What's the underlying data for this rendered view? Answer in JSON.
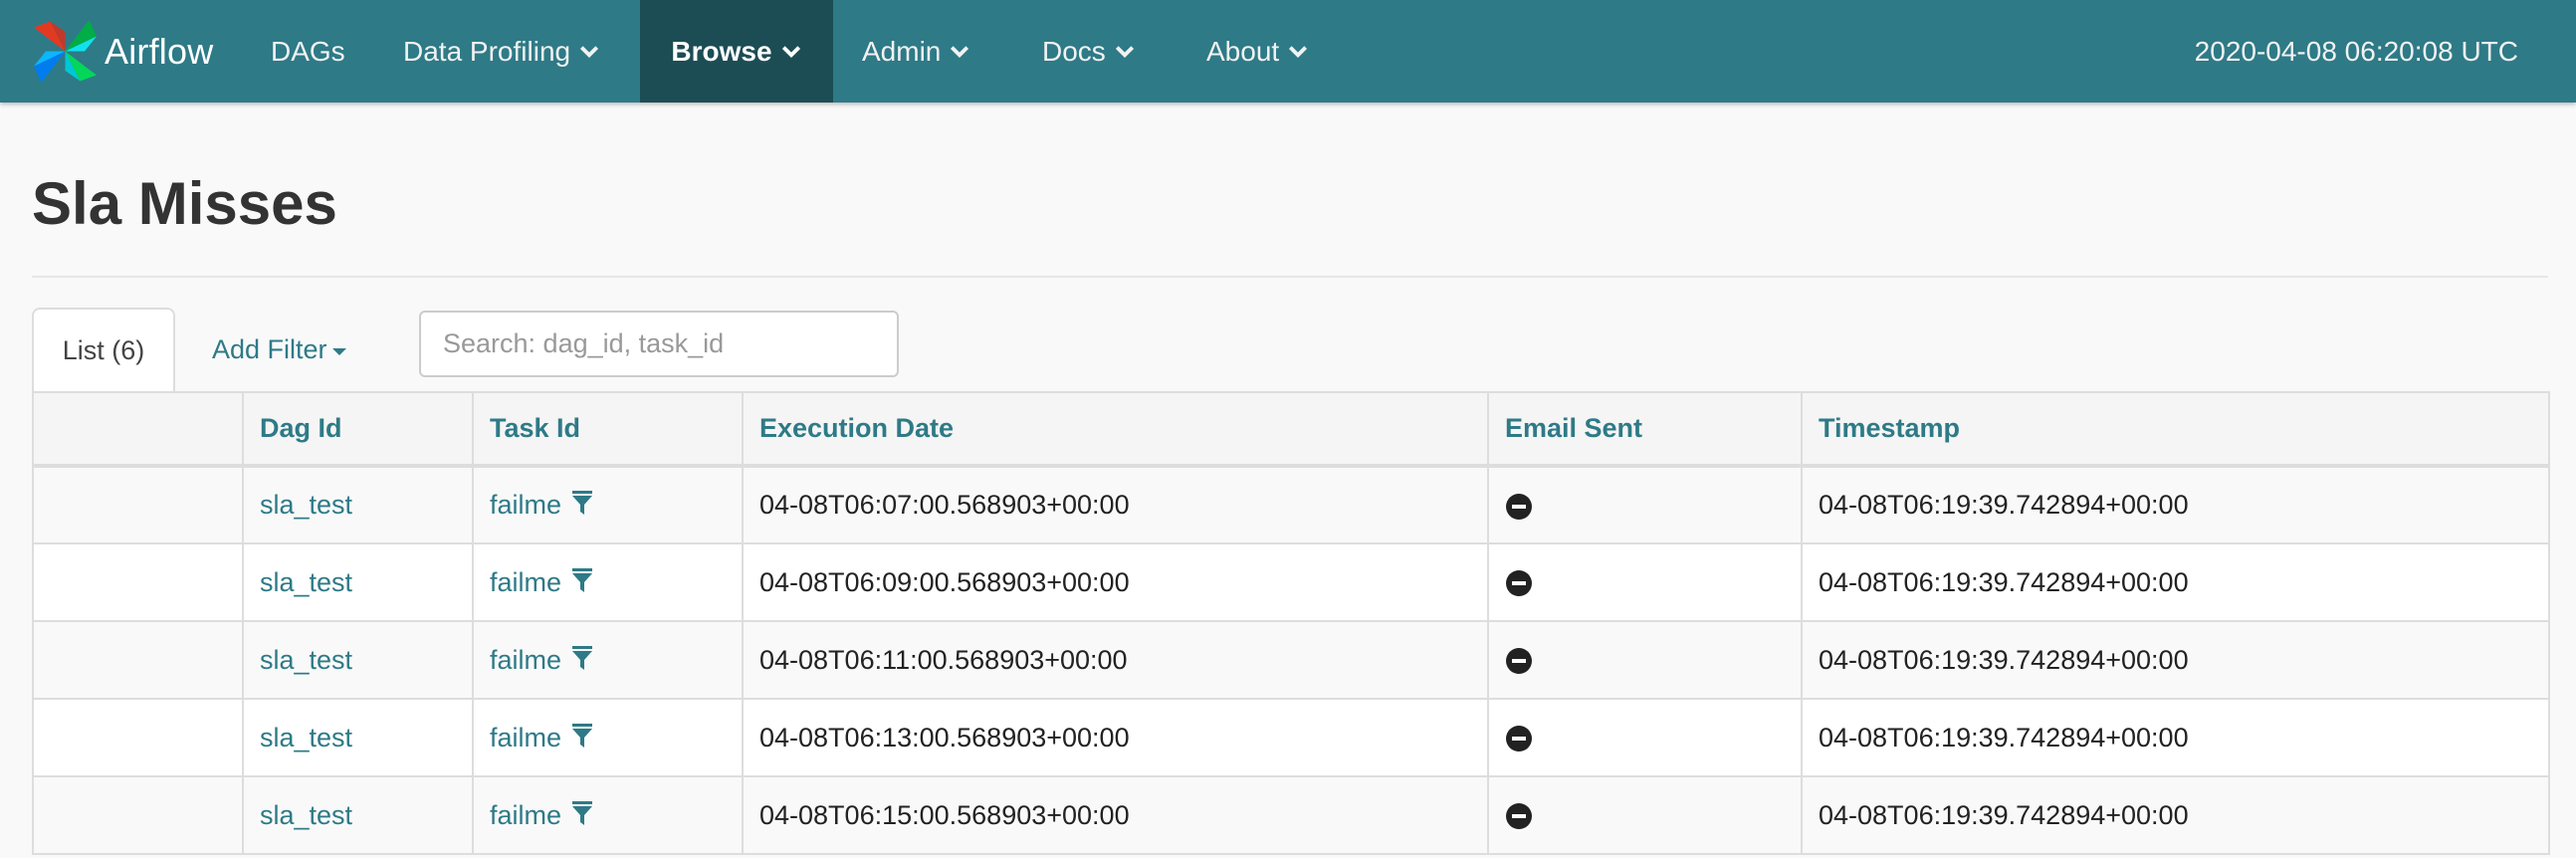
{
  "navbar": {
    "brand": "Airflow",
    "items": [
      {
        "label": "DAGs",
        "dropdown": false,
        "active": false
      },
      {
        "label": "Data Profiling",
        "dropdown": true,
        "active": false
      },
      {
        "label": "Browse",
        "dropdown": true,
        "active": true
      },
      {
        "label": "Admin",
        "dropdown": true,
        "active": false
      },
      {
        "label": "Docs",
        "dropdown": true,
        "active": false
      },
      {
        "label": "About",
        "dropdown": true,
        "active": false
      }
    ],
    "clock": "2020-04-08 06:20:08 UTC",
    "bg_color": "#2e7a87",
    "active_color": "#1c4d55"
  },
  "page": {
    "title": "Sla Misses"
  },
  "tabs": {
    "list_label": "List (6)",
    "add_filter_label": "Add Filter"
  },
  "search": {
    "placeholder": "Search: dag_id, task_id",
    "value": ""
  },
  "table": {
    "columns": [
      "",
      "Dag Id",
      "Task Id",
      "Execution Date",
      "Email Sent",
      "Timestamp"
    ],
    "rows": [
      {
        "dag_id": "sla_test",
        "task_id": "failme",
        "execution_date": "04-08T06:07:00.568903+00:00",
        "email_sent": "minus-circle-icon",
        "timestamp": "04-08T06:19:39.742894+00:00"
      },
      {
        "dag_id": "sla_test",
        "task_id": "failme",
        "execution_date": "04-08T06:09:00.568903+00:00",
        "email_sent": "minus-circle-icon",
        "timestamp": "04-08T06:19:39.742894+00:00"
      },
      {
        "dag_id": "sla_test",
        "task_id": "failme",
        "execution_date": "04-08T06:11:00.568903+00:00",
        "email_sent": "minus-circle-icon",
        "timestamp": "04-08T06:19:39.742894+00:00"
      },
      {
        "dag_id": "sla_test",
        "task_id": "failme",
        "execution_date": "04-08T06:13:00.568903+00:00",
        "email_sent": "minus-circle-icon",
        "timestamp": "04-08T06:19:39.742894+00:00"
      },
      {
        "dag_id": "sla_test",
        "task_id": "failme",
        "execution_date": "04-08T06:15:00.568903+00:00",
        "email_sent": "minus-circle-icon",
        "timestamp": "04-08T06:19:39.742894+00:00"
      }
    ]
  },
  "colors": {
    "link": "#2e7a87",
    "page_bg": "#f9f9f9"
  }
}
